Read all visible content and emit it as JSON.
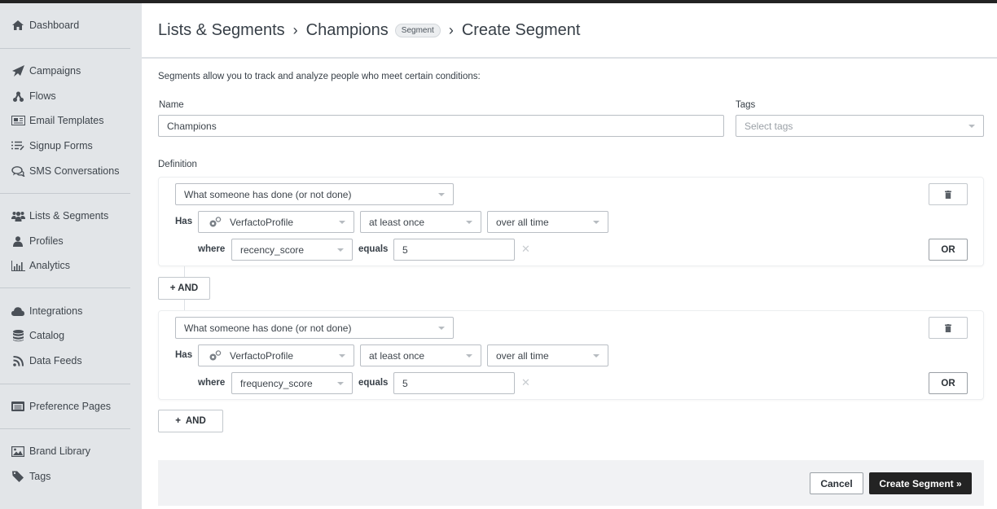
{
  "sidebar": {
    "items": [
      {
        "label": "Dashboard",
        "icon": "home-icon"
      },
      {
        "label": "Campaigns",
        "icon": "paper-plane-icon"
      },
      {
        "label": "Flows",
        "icon": "flow-icon"
      },
      {
        "label": "Email Templates",
        "icon": "email-template-icon"
      },
      {
        "label": "Signup Forms",
        "icon": "signup-form-icon"
      },
      {
        "label": "SMS Conversations",
        "icon": "chat-bubbles-icon"
      },
      {
        "label": "Lists & Segments",
        "icon": "users-icon"
      },
      {
        "label": "Profiles",
        "icon": "user-icon"
      },
      {
        "label": "Analytics",
        "icon": "bar-chart-icon"
      },
      {
        "label": "Integrations",
        "icon": "cloud-icon"
      },
      {
        "label": "Catalog",
        "icon": "database-icon"
      },
      {
        "label": "Data Feeds",
        "icon": "rss-icon"
      },
      {
        "label": "Preference Pages",
        "icon": "preference-page-icon"
      },
      {
        "label": "Brand Library",
        "icon": "image-icon"
      },
      {
        "label": "Tags",
        "icon": "tag-icon"
      }
    ]
  },
  "header": {
    "breadcrumb": [
      "Lists & Segments",
      "Champions",
      "Create Segment"
    ],
    "separator": "›",
    "badge": "Segment"
  },
  "form": {
    "intro": "Segments allow you to track and analyze people who meet certain conditions:",
    "name_label": "Name",
    "name_value": "Champions",
    "tags_label": "Tags",
    "tags_placeholder": "Select tags",
    "definition_label": "Definition"
  },
  "conditions": [
    {
      "type": "What someone has done (or not done)",
      "has_label": "Has",
      "metric": "VerfactoProfile",
      "frequency": "at least once",
      "timeframe": "over all time",
      "where_label": "where",
      "property": "recency_score",
      "operator": "equals",
      "value": "5",
      "or_label": "OR"
    },
    {
      "type": "What someone has done (or not done)",
      "has_label": "Has",
      "metric": "VerfactoProfile",
      "frequency": "at least once",
      "timeframe": "over all time",
      "where_label": "where",
      "property": "frequency_score",
      "operator": "equals",
      "value": "5",
      "or_label": "OR"
    }
  ],
  "and_buttons": [
    "+ AND",
    "+  AND"
  ],
  "footer": {
    "cancel": "Cancel",
    "create": "Create Segment »"
  },
  "colors": {
    "sidebar_bg": "#e2e5e8",
    "primary_button": "#232323",
    "footer_bg": "#f1f2f4"
  }
}
